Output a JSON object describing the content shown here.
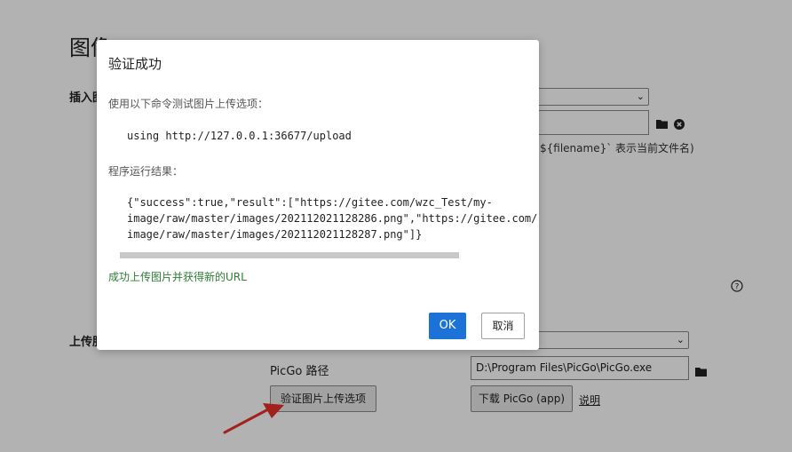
{
  "background": {
    "heading": "图像",
    "insert_label": "插入图",
    "filename_hint": "`${filename}` 表示当前文件名)",
    "upload_label": "上传服",
    "picgo_path_label": "PicGo 路径",
    "picgo_path_value": "D:\\Program Files\\PicGo\\PicGo.exe",
    "verify_button": "验证图片上传选项",
    "download_button": "下载 PicGo (app)",
    "explain_link": "说明"
  },
  "dialog": {
    "title": "验证成功",
    "command_label": "使用以下命令测试图片上传选项：",
    "command": "using http://127.0.0.1:36677/upload",
    "result_label": "程序运行结果：",
    "result_lines": [
      "{\"success\":true,\"result\":[\"https://gitee.com/wzc_Test/my-",
      "image/raw/master/images/202112021128286.png\",\"https://gitee.com/",
      "image/raw/master/images/202112021128287.png\"]}"
    ],
    "success_message": "成功上传图片并获得新的URL",
    "ok_label": "OK",
    "cancel_label": "取消"
  },
  "colors": {
    "ok_button": "#1d72d8",
    "success_text": "#2e7d32",
    "arrow": "#e8302a"
  },
  "icons": [
    "folder-icon",
    "clear-icon",
    "help-icon",
    "chevron-down-icon"
  ]
}
